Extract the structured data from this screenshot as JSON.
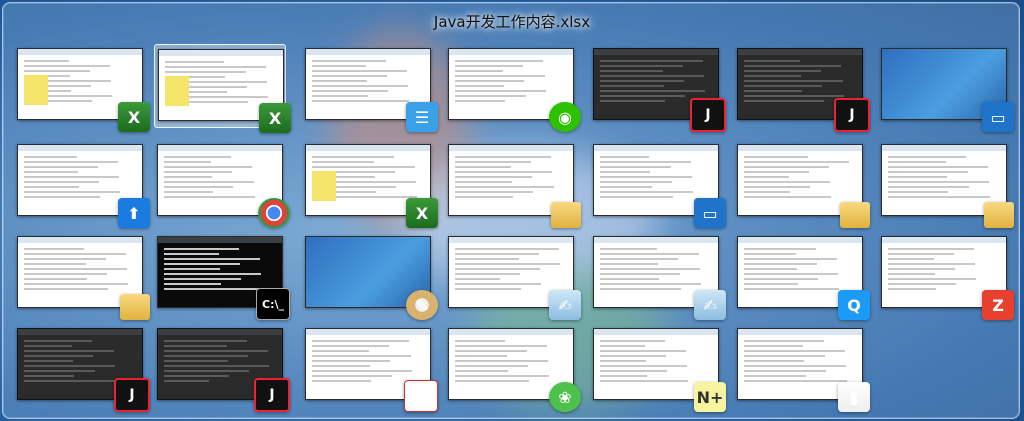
{
  "switcher": {
    "active_title": "Java开发工作内容.xlsx",
    "rows": [
      [
        {
          "app": "excel",
          "thumb": "light",
          "badge": "excel",
          "selected": false
        },
        {
          "app": "excel",
          "thumb": "light",
          "badge": "excel",
          "selected": true
        },
        {
          "app": "chat",
          "thumb": "light",
          "badge": "chat",
          "selected": false
        },
        {
          "app": "wechat",
          "thumb": "light",
          "badge": "wechat",
          "selected": false
        },
        {
          "app": "intellij",
          "thumb": "dark",
          "badge": "ij",
          "selected": false
        },
        {
          "app": "intellij",
          "thumb": "dark",
          "badge": "ij",
          "selected": false
        },
        {
          "app": "desktop",
          "thumb": "desk",
          "badge": "screen",
          "selected": false
        }
      ],
      [
        {
          "app": "upload",
          "thumb": "light",
          "badge": "arrow",
          "selected": false
        },
        {
          "app": "chrome",
          "thumb": "light",
          "badge": "chrome",
          "selected": false
        },
        {
          "app": "excel",
          "thumb": "light",
          "badge": "excel",
          "selected": false
        },
        {
          "app": "explorer",
          "thumb": "light",
          "badge": "folder",
          "selected": false
        },
        {
          "app": "control-panel",
          "thumb": "light",
          "badge": "screen",
          "selected": false
        },
        {
          "app": "explorer",
          "thumb": "light",
          "badge": "folder",
          "selected": false
        },
        {
          "app": "explorer",
          "thumb": "light",
          "badge": "folder",
          "selected": false
        }
      ],
      [
        {
          "app": "explorer",
          "thumb": "light",
          "badge": "folder",
          "selected": false
        },
        {
          "app": "cmd",
          "thumb": "black",
          "badge": "cmd",
          "selected": false
        },
        {
          "app": "paint",
          "thumb": "desk",
          "badge": "paint",
          "selected": false
        },
        {
          "app": "notepad",
          "thumb": "light",
          "badge": "note",
          "selected": false
        },
        {
          "app": "notepad",
          "thumb": "light",
          "badge": "note",
          "selected": false
        },
        {
          "app": "qq",
          "thumb": "light",
          "badge": "qq",
          "selected": false
        },
        {
          "app": "filezilla",
          "thumb": "light",
          "badge": "red",
          "selected": false
        }
      ],
      [
        {
          "app": "intellij",
          "thumb": "dark",
          "badge": "ij",
          "selected": false
        },
        {
          "app": "intellij",
          "thumb": "dark",
          "badge": "ij",
          "selected": false
        },
        {
          "app": "table",
          "thumb": "light",
          "badge": "table",
          "selected": false
        },
        {
          "app": "wechat-dev",
          "thumb": "light",
          "badge": "leaf",
          "selected": false
        },
        {
          "app": "notepad-plus",
          "thumb": "light",
          "badge": "np",
          "selected": false
        },
        {
          "app": "chart-app",
          "thumb": "light",
          "badge": "chart",
          "selected": false
        }
      ]
    ],
    "badge_glyphs": {
      "excel": "X",
      "ij": "J",
      "folder": "",
      "chrome": "",
      "arrow": "⬆",
      "chat": "☰",
      "wechat": "◉",
      "paint": "✎",
      "note": "✍",
      "qq": "Q",
      "red": "Z",
      "cmd": "C:\\_",
      "table": "▦",
      "chart": "▮",
      "screen": "▭",
      "leaf": "❀",
      "np": "N+"
    }
  }
}
